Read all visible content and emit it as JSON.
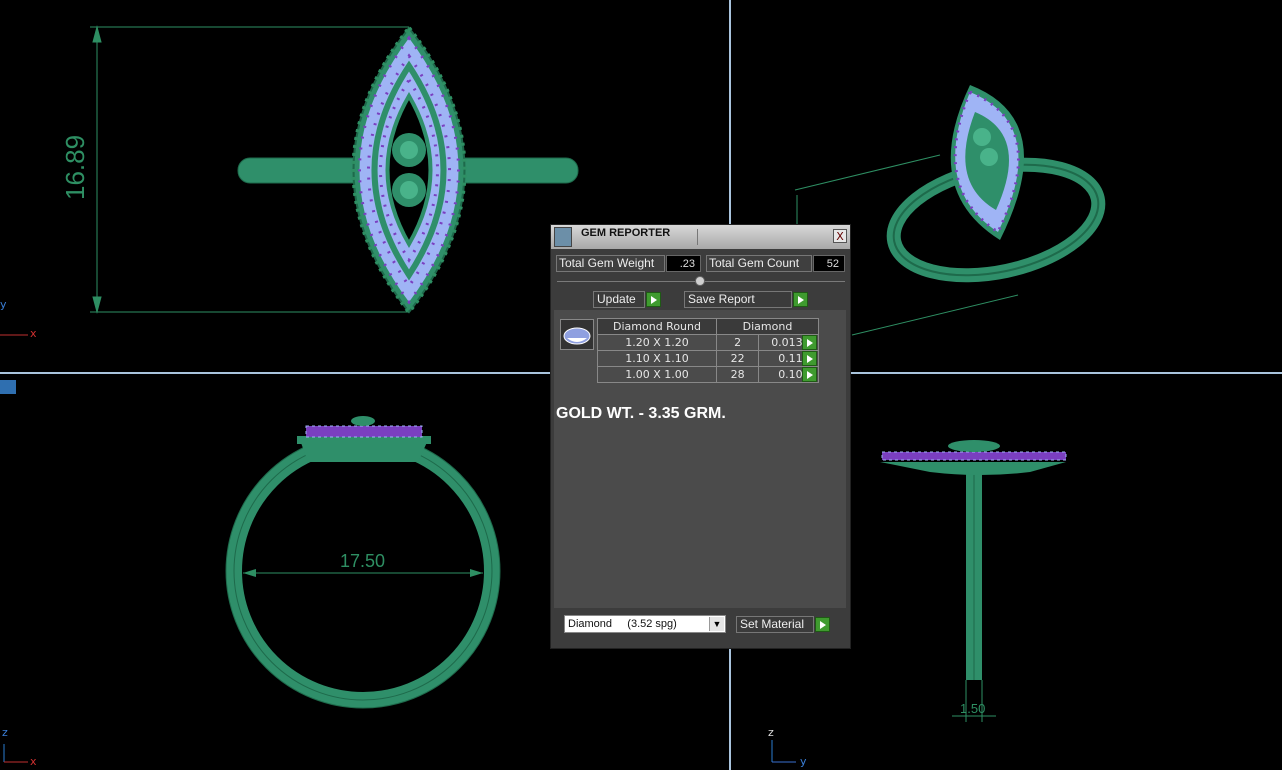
{
  "viewports": {
    "top": {
      "dimension": "16.89",
      "axis_y": "y",
      "axis_x": "x"
    },
    "front": {
      "dimension": "17.50",
      "axis_z": "z",
      "axis_x": "x"
    },
    "side": {
      "dimension": "1.50",
      "axis_z": "z",
      "axis_y": "y"
    }
  },
  "gem_reporter": {
    "title": "GEM REPORTER",
    "close": "X",
    "total_gem_weight_label": "Total Gem Weight",
    "total_gem_weight_value": ".23",
    "total_gem_count_label": "Total Gem Count",
    "total_gem_count_value": "52",
    "update_label": "Update",
    "save_report_label": "Save Report",
    "table": {
      "col_shape": "Diamond Round",
      "col_material": "Diamond",
      "rows": [
        {
          "size": "1.20 X 1.20",
          "count": "2",
          "weight": "0.013tw"
        },
        {
          "size": "1.10 X 1.10",
          "count": "22",
          "weight": "0.11tw"
        },
        {
          "size": "1.00 X 1.00",
          "count": "28",
          "weight": "0.10tw"
        }
      ]
    },
    "gold_weight": "GOLD WT. - 3.35 GRM.",
    "material_select": "Diamond     (3.52 spg)",
    "set_material_label": "Set Material"
  },
  "colors": {
    "metal": "#2f8f6a",
    "metal_dark": "#1e6a4b",
    "pave": "#9fb4f5",
    "gem_purple": "#7a3fc0",
    "dimension": "#2e8f63"
  }
}
